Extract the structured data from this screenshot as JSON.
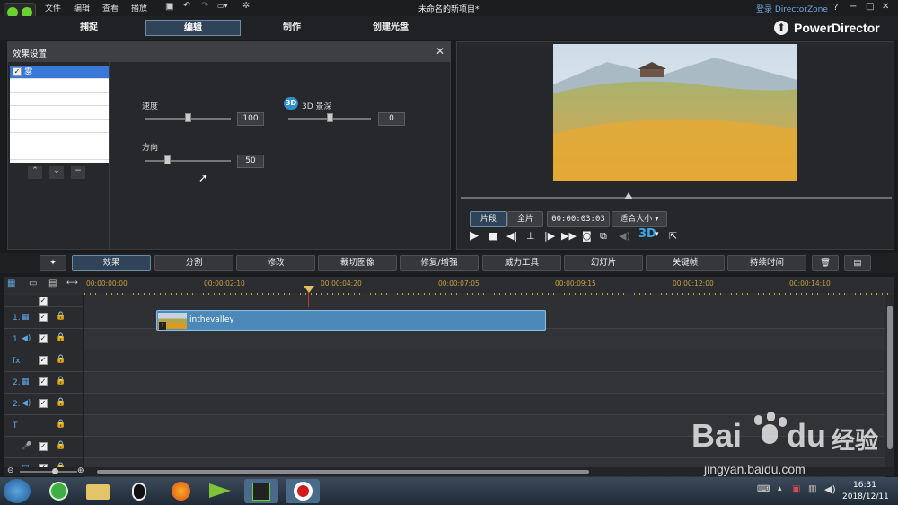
{
  "menu": [
    "文件",
    "编辑",
    "查看",
    "播放"
  ],
  "window_title": "未命名的新项目*",
  "login_link": "登录 DirectorZone",
  "help": "?",
  "mode_tabs": [
    "捕捉",
    "编辑",
    "制作",
    "创建光盘"
  ],
  "brand": "PowerDirector",
  "fx_panel": {
    "title": "效果设置",
    "effect_item": "雾",
    "speed_label": "速度",
    "speed_value": "100",
    "depth_label": "3D 景深",
    "depth_value": "0",
    "direction_label": "方向",
    "direction_value": "50",
    "depth_icon": "3D"
  },
  "preview": {
    "mode_clip": "片段",
    "mode_full": "全片",
    "timecode": "00:00:03:03",
    "fit_label": "适合大小",
    "three_d": "3D"
  },
  "toolbar": [
    "效果",
    "分割",
    "修改",
    "裁切图像",
    "修复/增强",
    "威力工具",
    "幻灯片",
    "关键帧",
    "持续时间"
  ],
  "timeline": {
    "ruler": [
      "00:00:00:00",
      "00:00:02:10",
      "00:00:04:20",
      "00:00:07:05",
      "00:00:09:15",
      "00:00:12:00",
      "00:00:14:10"
    ],
    "clip_name": "inthevalley",
    "track_labels": [
      "1.",
      "1.",
      "fx",
      "2.",
      "2.",
      "T",
      "",
      ""
    ]
  },
  "taskbar": {
    "time": "16:31",
    "date": "2018/12/11"
  },
  "watermark": {
    "brand": "Bai",
    "brand2": "du",
    "cn": "经验",
    "url": "jingyan.baidu.com"
  }
}
